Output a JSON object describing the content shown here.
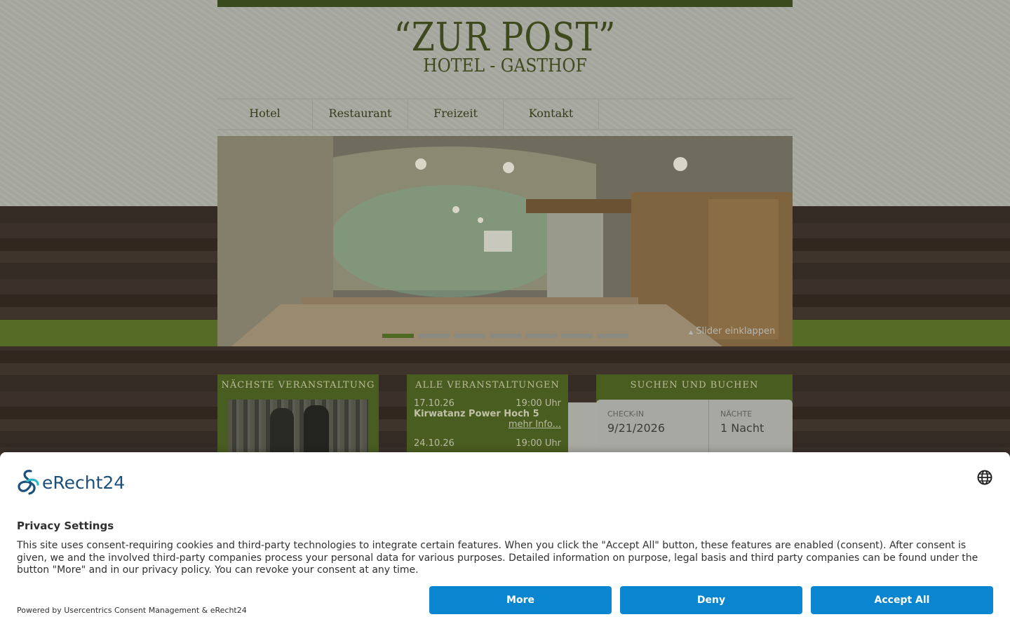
{
  "site": {
    "logo_title": "“ZUR POST”",
    "logo_subtitle": "HOTEL - GASTHOF"
  },
  "nav": {
    "items": [
      {
        "label": "Hotel"
      },
      {
        "label": "Restaurant"
      },
      {
        "label": "Freizeit"
      },
      {
        "label": "Kontakt"
      }
    ]
  },
  "slider": {
    "toggle_label": "Slider einklappen",
    "dots_total": 7,
    "active_dot": 1
  },
  "next_event": {
    "title": "NÄCHSTE VERANSTALTUNG"
  },
  "all_events": {
    "title": "ALLE VERANSTALTUNGEN",
    "events": [
      {
        "date": "17.10.26",
        "time": "19:00 Uhr",
        "name": "Kirwatanz Power Hoch 5",
        "more": "mehr Info..."
      },
      {
        "date": "24.10.26",
        "time": "19:00 Uhr"
      }
    ]
  },
  "booking": {
    "title": "SUCHEN UND BUCHEN",
    "checkin_label": "CHECK-IN",
    "checkin_value": "9/21/2026",
    "nights_label": "NÄCHTE",
    "nights_value": "1 Nacht"
  },
  "consent": {
    "logo_text": "eRecht24",
    "title": "Privacy Settings",
    "text": "This site uses consent-requiring cookies and third-party technologies to integrate certain features. When you click the \"Accept All\" button, these features are enabled (consent). After consent is given, we and the involved third-party companies process your personal data for various purposes. Detailed information on purpose, legal basis and third party companies can be found under the button \"More\" and in our privacy policy. You can revoke your consent at any time.",
    "powered_by": "Powered by Usercentrics Consent Management & eRecht24",
    "more_label": "More",
    "deny_label": "Deny",
    "accept_label": "Accept All",
    "button_color": "#0a86d0"
  }
}
